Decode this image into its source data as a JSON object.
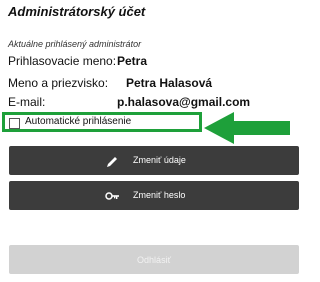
{
  "account": {
    "title": "Administrátorský účet",
    "subtitle": "Aktuálne prihlásený administrátor",
    "fields": [
      {
        "label": "Prihlasovacie meno:",
        "value": "Petra"
      },
      {
        "label": "Meno a priezvisko:",
        "value": "Petra Halasová"
      },
      {
        "label": "E-mail:",
        "value": "p.halasova@gmail.com"
      }
    ]
  },
  "auto_login": {
    "label": "Automatické prihlásenie",
    "checked": false
  },
  "actions": {
    "edit_label": "Zmeniť údaje",
    "edit_icon": "pencil-icon",
    "password_label": "Zmeniť heslo",
    "password_icon": "key-icon",
    "logout_label": "Odhlásiť"
  },
  "colors": {
    "highlight": "#1ea03a",
    "button_dark": "#3c3c3c",
    "button_disabled": "#d2d2d2"
  }
}
